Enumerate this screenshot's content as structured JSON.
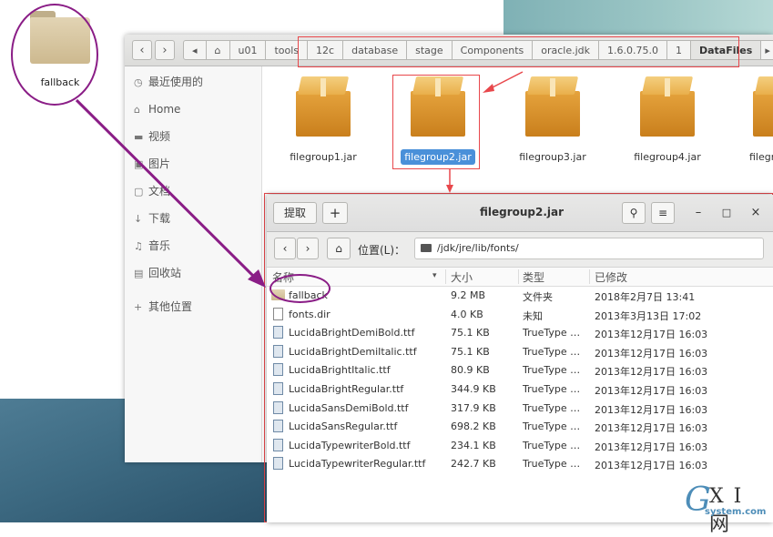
{
  "desktop": {
    "folder_label": "fallback"
  },
  "back_window": {
    "nav_back": "‹",
    "nav_forward": "›",
    "crumb_prev": "◂",
    "home_glyph": "⌂",
    "breadcrumbs": [
      "u01",
      "tools",
      "12c",
      "database",
      "stage",
      "Components",
      "oracle.jdk",
      "1.6.0.75.0",
      "1",
      "DataFiles"
    ],
    "crumb_more": "▸",
    "sidebar": [
      {
        "icon": "◷",
        "label": "最近使用的"
      },
      {
        "icon": "⌂",
        "label": "Home"
      },
      {
        "icon": "▬",
        "label": "视频"
      },
      {
        "icon": "▣",
        "label": "图片"
      },
      {
        "icon": "▢",
        "label": "文档"
      },
      {
        "icon": "↓",
        "label": "下载"
      },
      {
        "icon": "♫",
        "label": "音乐"
      },
      {
        "icon": "▤",
        "label": "回收站"
      },
      {
        "icon": "+",
        "label": "其他位置"
      }
    ],
    "files": [
      "filegroup1.jar",
      "filegroup2.jar",
      "filegroup3.jar",
      "filegroup4.jar",
      "filegr"
    ]
  },
  "front_window": {
    "extract_button": "提取",
    "add_button": "+",
    "title": "filegroup2.jar",
    "search_glyph": "⚲",
    "menu_glyph": "≡",
    "minimize_glyph": "–",
    "maximize_glyph": "□",
    "close_glyph": "×",
    "back_glyph": "‹",
    "forward_glyph": "›",
    "home_glyph": "⌂",
    "location_label": "位置(L)：",
    "location_path": "/jdk/jre/lib/fonts/",
    "columns": {
      "name": "名称",
      "sort": "▾",
      "size": "大小",
      "type": "类型",
      "modified": "已修改"
    },
    "rows": [
      {
        "name": "fallback",
        "size": "9.2 MB",
        "type": "文件夹",
        "modified": "2018年2月7日 13:41",
        "kind": "folder"
      },
      {
        "name": "fonts.dir",
        "size": "4.0 KB",
        "type": "未知",
        "modified": "2013年3月13日 17:02",
        "kind": "plain"
      },
      {
        "name": "LucidaBrightDemiBold.ttf",
        "size": "75.1 KB",
        "type": "TrueType …",
        "modified": "2013年12月17日 16:03",
        "kind": "font"
      },
      {
        "name": "LucidaBrightDemiItalic.ttf",
        "size": "75.1 KB",
        "type": "TrueType …",
        "modified": "2013年12月17日 16:03",
        "kind": "font"
      },
      {
        "name": "LucidaBrightItalic.ttf",
        "size": "80.9 KB",
        "type": "TrueType …",
        "modified": "2013年12月17日 16:03",
        "kind": "font"
      },
      {
        "name": "LucidaBrightRegular.ttf",
        "size": "344.9 KB",
        "type": "TrueType …",
        "modified": "2013年12月17日 16:03",
        "kind": "font"
      },
      {
        "name": "LucidaSansDemiBold.ttf",
        "size": "317.9 KB",
        "type": "TrueType …",
        "modified": "2013年12月17日 16:03",
        "kind": "font"
      },
      {
        "name": "LucidaSansRegular.ttf",
        "size": "698.2 KB",
        "type": "TrueType …",
        "modified": "2013年12月17日 16:03",
        "kind": "font"
      },
      {
        "name": "LucidaTypewriterBold.ttf",
        "size": "234.1 KB",
        "type": "TrueType …",
        "modified": "2013年12月17日 16:03",
        "kind": "font"
      },
      {
        "name": "LucidaTypewriterRegular.ttf",
        "size": "242.7 KB",
        "type": "TrueType …",
        "modified": "2013年12月17日 16:03",
        "kind": "font"
      }
    ]
  },
  "watermark": {
    "g": "G",
    "xi": "X I 网",
    "domain": "system.com"
  },
  "colors": {
    "annotation_red": "#e8474b",
    "annotation_purple": "#8a1d86",
    "selection_blue": "#4a90d9"
  }
}
